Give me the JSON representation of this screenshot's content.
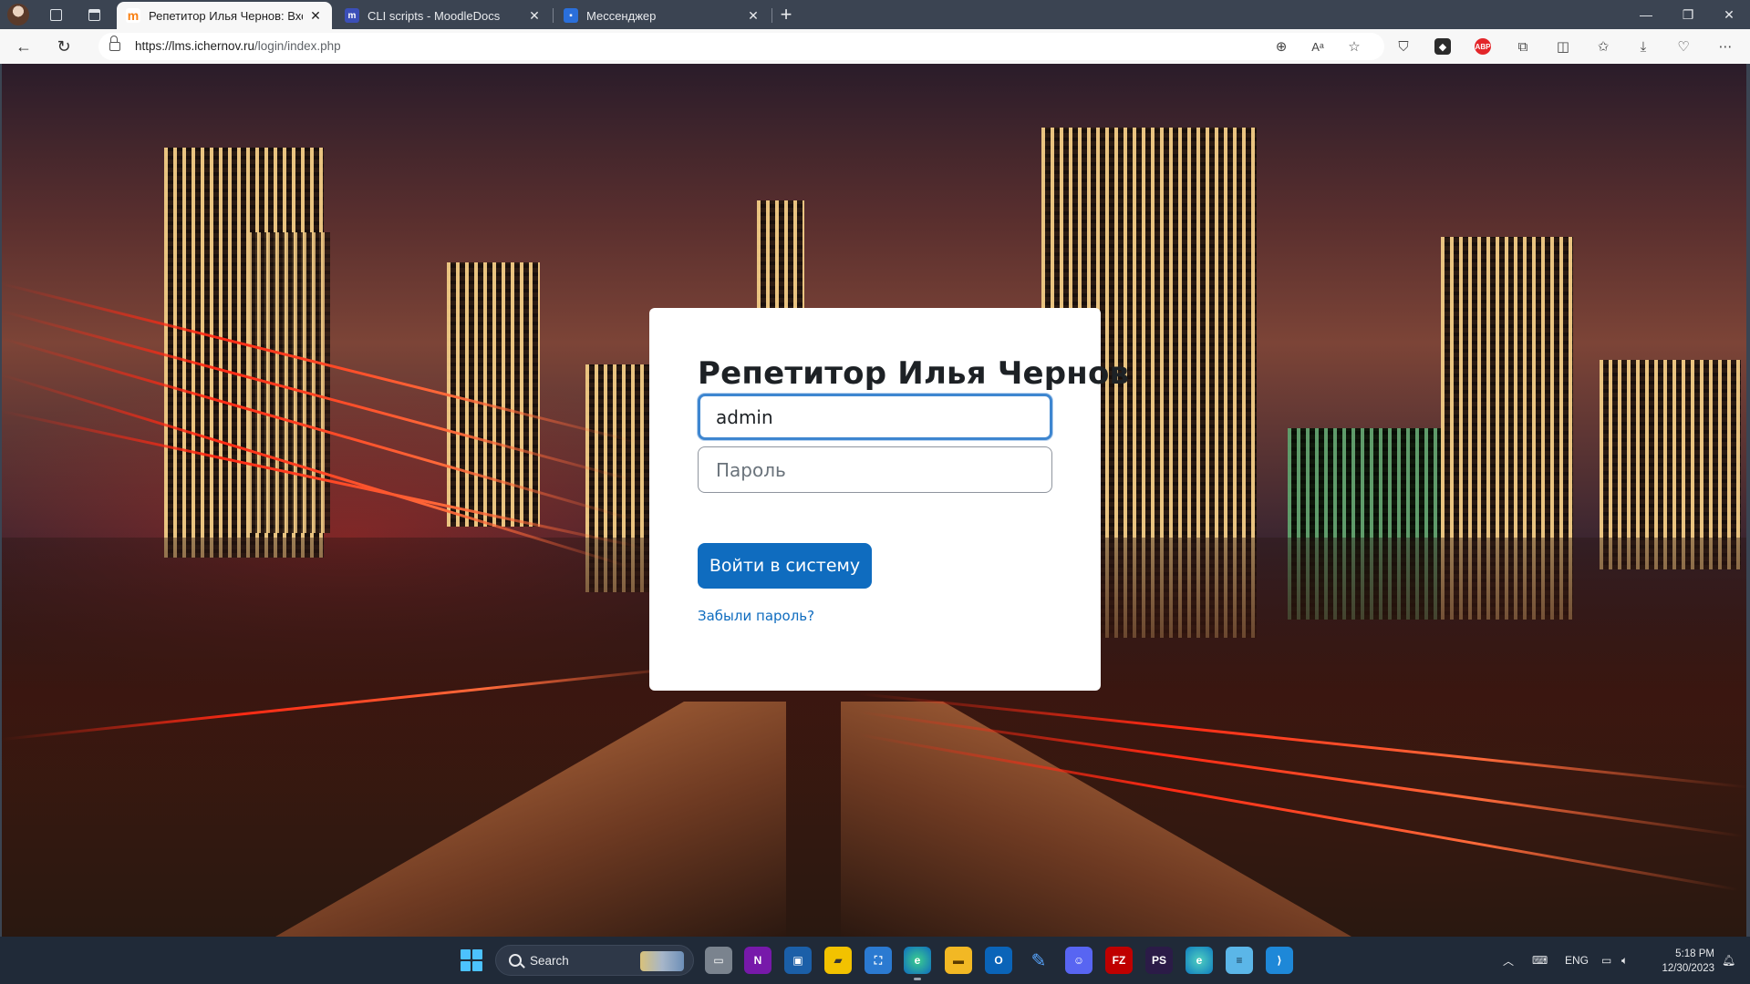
{
  "browser": {
    "tabs": [
      {
        "title": "Репетитор Илья Чернов: Вход н",
        "favicon_letter": "m",
        "favicon_color": "#f98012",
        "active": true
      },
      {
        "title": "CLI scripts - MoodleDocs",
        "favicon_letter": "m",
        "favicon_color": "#3b4fb8",
        "active": false
      },
      {
        "title": "Мессенджер",
        "favicon_letter": "",
        "favicon_color": "#2a6fdb",
        "active": false
      }
    ],
    "url_host": "https://lms.ichernov.ru",
    "url_path": "/login/index.php",
    "new_tab_symbol": "+",
    "window_controls": {
      "minimize": "—",
      "maximize": "❐",
      "close": "✕"
    },
    "extensions": {
      "abp": "ABP"
    }
  },
  "login": {
    "site_title": "Репетитор Илья Чернов",
    "username_value": "admin",
    "password_placeholder": "Пароль",
    "submit_label": "Войти в систему",
    "forgot_link": "Забыли пароль?"
  },
  "taskbar": {
    "search_label": "Search",
    "language": "ENG",
    "time": "5:18 PM",
    "date": "12/30/2023",
    "apps": [
      "file-explorer-icon",
      "onenote-icon",
      "vscode-terminal-icon",
      "sticky-notes-icon",
      "store-icon",
      "edge-icon",
      "files-icon",
      "outlook-icon",
      "pen-icon",
      "discord-icon",
      "filezilla-icon",
      "phpstorm-icon",
      "edge-dev-icon",
      "notepad-icon",
      "vscode-icon"
    ]
  },
  "colors": {
    "accent": "#0f6cbf",
    "focus_ring": "#3e86d0",
    "taskbar_bg": "#202a38",
    "chrome_bg": "#3b4452"
  }
}
